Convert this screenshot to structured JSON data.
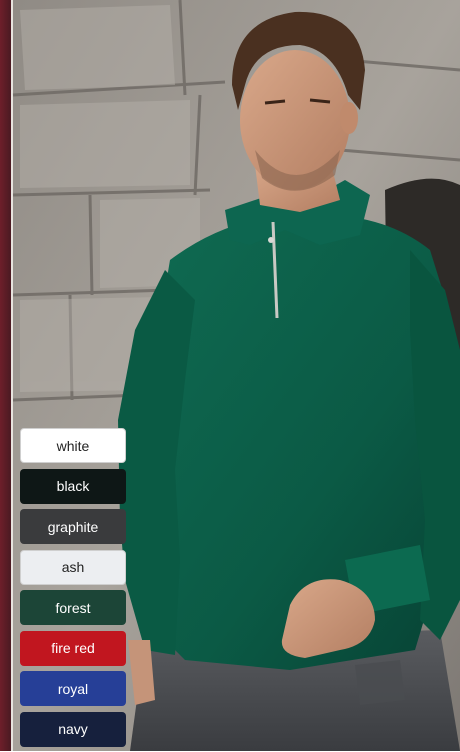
{
  "product_photo": {
    "icon": "model-wearing-green-quarter-zip-sweatshirt"
  },
  "swatches": [
    {
      "label": "white",
      "color": "#ffffff",
      "text_color": "#222222"
    },
    {
      "label": "black",
      "color": "#0e1716",
      "text_color": "#ffffff"
    },
    {
      "label": "graphite",
      "color": "#3a3b3d",
      "text_color": "#ffffff"
    },
    {
      "label": "ash",
      "color": "#eceef1",
      "text_color": "#222222"
    },
    {
      "label": "forest",
      "color": "#1c4537",
      "text_color": "#ffffff"
    },
    {
      "label": "fire red",
      "color": "#c1161f",
      "text_color": "#ffffff"
    },
    {
      "label": "royal",
      "color": "#263f97",
      "text_color": "#ffffff"
    },
    {
      "label": "navy",
      "color": "#16203d",
      "text_color": "#ffffff"
    }
  ]
}
